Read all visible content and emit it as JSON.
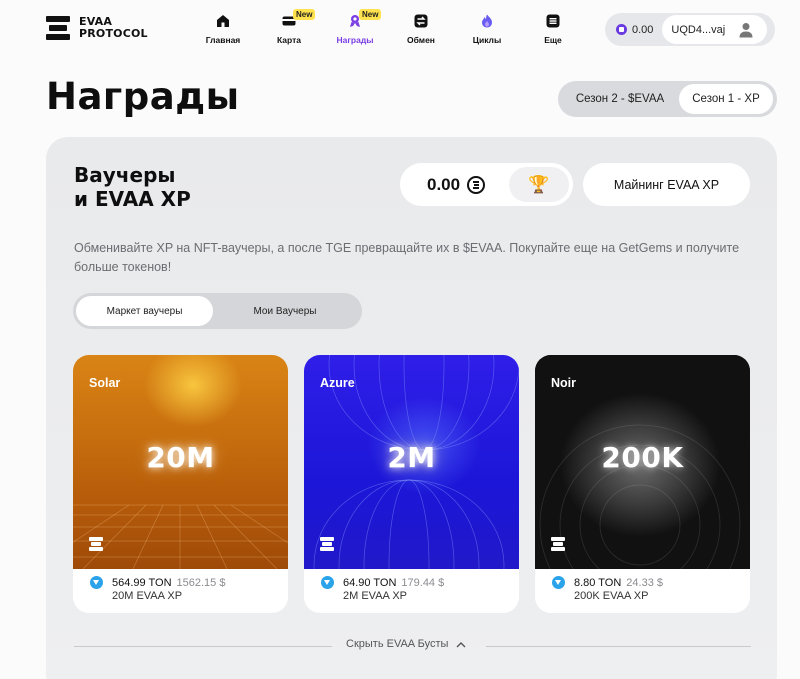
{
  "logo": {
    "text": "EVAA\nPROTOCOL"
  },
  "nav": {
    "items": [
      {
        "label": "Главная",
        "icon": "home-icon",
        "badge": ""
      },
      {
        "label": "Карта",
        "icon": "card-icon",
        "badge": "New"
      },
      {
        "label": "Награды",
        "icon": "rewards-icon",
        "badge": "New",
        "active": true
      },
      {
        "label": "Обмен",
        "icon": "swap-icon",
        "badge": ""
      },
      {
        "label": "Циклы",
        "icon": "flame-icon",
        "badge": ""
      },
      {
        "label": "Еще",
        "icon": "more-icon",
        "badge": ""
      }
    ]
  },
  "wallet": {
    "balance": "0.00",
    "address": "UQD4...vaj"
  },
  "page": {
    "title": "Награды"
  },
  "season": {
    "season2": "Сезон 2 - $EVAA",
    "season1": "Сезон 1 - XP",
    "active": "season1"
  },
  "panel": {
    "title": "Ваучеры\nи EVAA XP",
    "xp_value": "0.00",
    "trophy_icon": "🏆",
    "mining_button": "Майнинг EVAA XP",
    "description": "Обменивайте XP на NFT-ваучеры, а после TGE превращайте их в $EVAA. Покупайте еще на GetGems и получите больше токенов!",
    "tabs": {
      "market": "Маркет ваучеры",
      "mine": "Мои Ваучеры",
      "active": "market"
    }
  },
  "cards": [
    {
      "name": "Solar",
      "amount": "20M",
      "ton_price": "564.99 TON",
      "usd_price": "1562.15 $",
      "subtitle": "20M EVAA XP"
    },
    {
      "name": "Azure",
      "amount": "2M",
      "ton_price": "64.90 TON",
      "usd_price": "179.44 $",
      "subtitle": "2M EVAA XP"
    },
    {
      "name": "Noir",
      "amount": "200K",
      "ton_price": "8.80 TON",
      "usd_price": "24.33 $",
      "subtitle": "200K EVAA XP"
    }
  ],
  "boosts": {
    "hide_label": "Скрыть EVAA Бусты"
  },
  "colors": {
    "accent": "#7b3fe4",
    "badge": "#ffe24d",
    "ton": "#2aa3ea"
  }
}
